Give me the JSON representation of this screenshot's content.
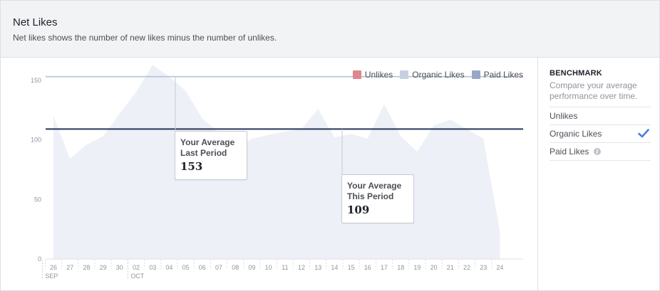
{
  "header": {
    "title": "Net Likes",
    "subtitle": "Net likes shows the number of new likes minus the number of unlikes."
  },
  "legend": [
    {
      "label": "Unlikes",
      "color": "#e0868e"
    },
    {
      "label": "Organic Likes",
      "color": "#c7d0e0"
    },
    {
      "label": "Paid Likes",
      "color": "#98a6c7"
    }
  ],
  "callouts": {
    "last_period": {
      "label_line1": "Your Average",
      "label_line2": "Last Period",
      "value": "153"
    },
    "this_period": {
      "label_line1": "Your Average",
      "label_line2": "This Period",
      "value": "109"
    }
  },
  "sidebar": {
    "title": "BENCHMARK",
    "description": "Compare your average performance over time.",
    "items": [
      {
        "label": "Unlikes"
      },
      {
        "label": "Organic Likes"
      },
      {
        "label": "Paid Likes"
      }
    ],
    "info_icon": "i"
  },
  "chart_data": {
    "type": "area",
    "categories": [
      "26",
      "27",
      "28",
      "29",
      "30",
      "02",
      "03",
      "04",
      "05",
      "06",
      "07",
      "08",
      "09",
      "10",
      "11",
      "12",
      "13",
      "14",
      "15",
      "16",
      "17",
      "18",
      "19",
      "20",
      "21",
      "22",
      "23",
      "24"
    ],
    "month_labels": [
      {
        "label": "SEP",
        "at": "26"
      },
      {
        "label": "OCT",
        "at": "02"
      }
    ],
    "series": [
      {
        "name": "Organic Likes",
        "color": "#edf0f7",
        "values": [
          120,
          84,
          96,
          103,
          122,
          140,
          163,
          153,
          141,
          118,
          106,
          92,
          101,
          104,
          107,
          109,
          126,
          102,
          105,
          101,
          130,
          103,
          90,
          112,
          117,
          109,
          101,
          23
        ]
      }
    ],
    "reference_lines": [
      {
        "value": 153,
        "color": "#b6c1d6"
      },
      {
        "value": 109,
        "color": "#27375a"
      }
    ],
    "yticks": [
      0,
      50,
      100,
      150
    ],
    "ylim": [
      0,
      160
    ]
  }
}
